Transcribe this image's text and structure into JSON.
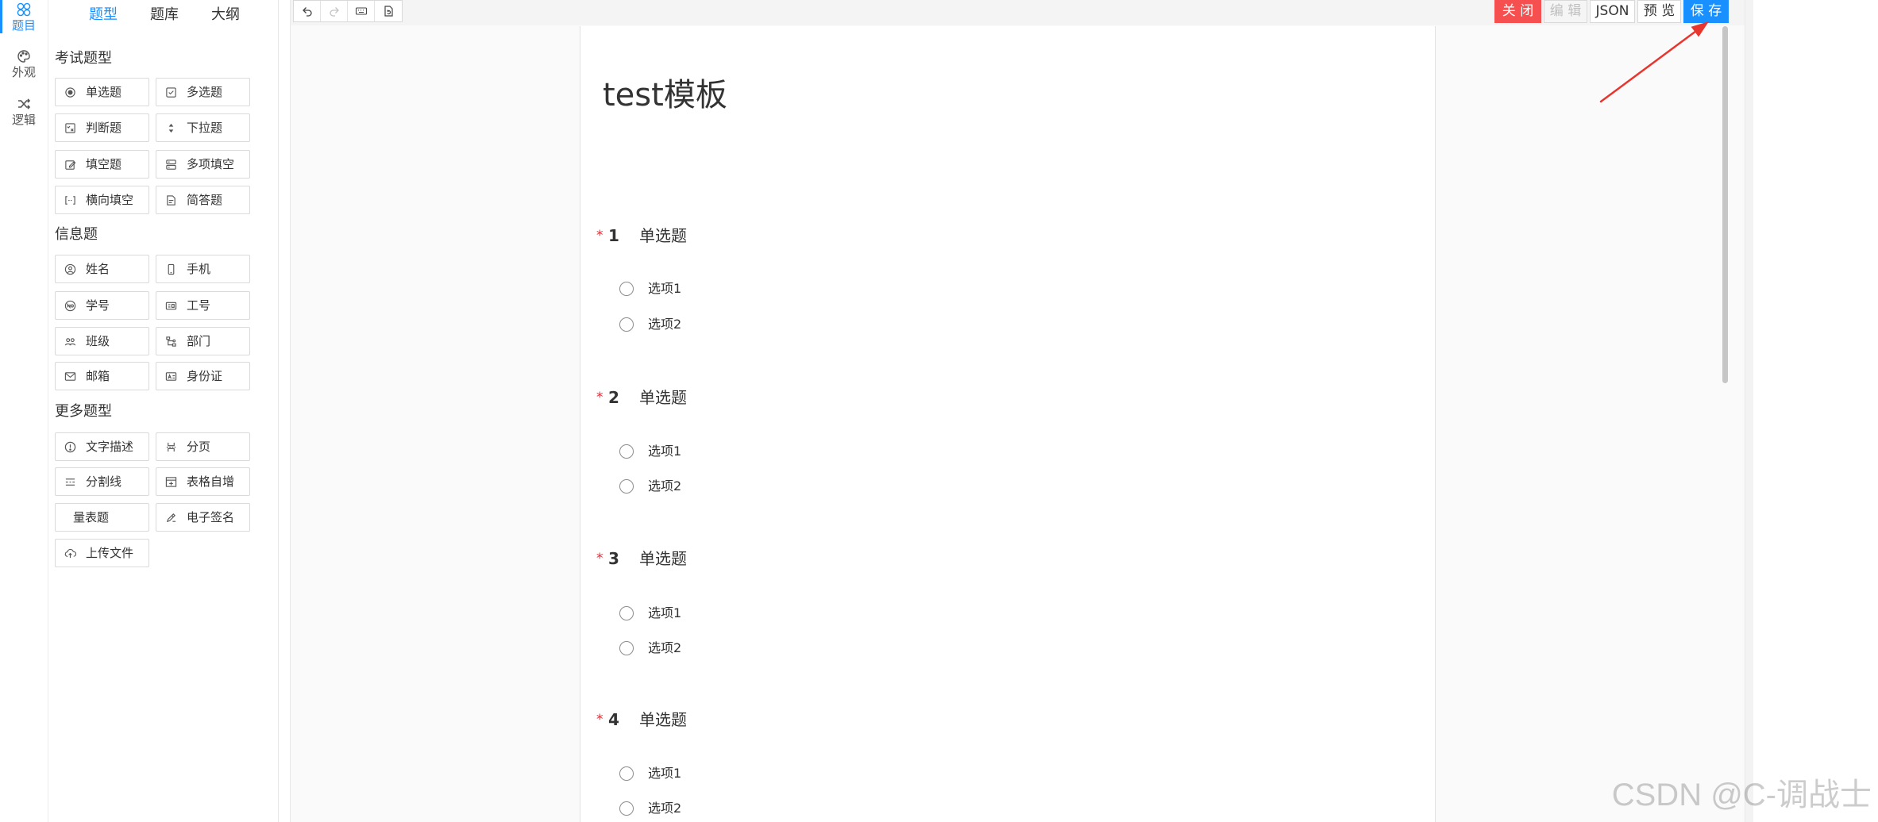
{
  "rail": {
    "items": [
      {
        "label": "题目",
        "icon": "apps-icon",
        "active": true
      },
      {
        "label": "外观",
        "icon": "palette-icon",
        "active": false
      },
      {
        "label": "逻辑",
        "icon": "shuffle-icon",
        "active": false
      }
    ]
  },
  "panel": {
    "tabs": [
      {
        "label": "题型",
        "active": true
      },
      {
        "label": "题库",
        "active": false
      },
      {
        "label": "大纲",
        "active": false
      }
    ],
    "groups": [
      {
        "title": "考试题型",
        "widgets": [
          {
            "label": "单选题",
            "icon": "radio-icon"
          },
          {
            "label": "多选题",
            "icon": "checkbox-icon"
          },
          {
            "label": "判断题",
            "icon": "true-false-icon"
          },
          {
            "label": "下拉题",
            "icon": "dropdown-icon"
          },
          {
            "label": "填空题",
            "icon": "fill-blank-icon"
          },
          {
            "label": "多项填空",
            "icon": "multi-fill-icon"
          },
          {
            "label": "横向填空",
            "icon": "inline-fill-icon"
          },
          {
            "label": "简答题",
            "icon": "short-answer-icon"
          }
        ]
      },
      {
        "title": "信息题",
        "widgets": [
          {
            "label": "姓名",
            "icon": "user-icon"
          },
          {
            "label": "手机",
            "icon": "phone-icon"
          },
          {
            "label": "学号",
            "icon": "student-no-icon"
          },
          {
            "label": "工号",
            "icon": "employee-id-icon"
          },
          {
            "label": "班级",
            "icon": "class-icon"
          },
          {
            "label": "部门",
            "icon": "department-icon"
          },
          {
            "label": "邮箱",
            "icon": "mail-icon"
          },
          {
            "label": "身份证",
            "icon": "id-card-icon"
          }
        ]
      },
      {
        "title": "更多题型",
        "widgets": [
          {
            "label": "文字描述",
            "icon": "info-icon"
          },
          {
            "label": "分页",
            "icon": "page-break-icon"
          },
          {
            "label": "分割线",
            "icon": "divider-icon"
          },
          {
            "label": "表格自增",
            "icon": "table-add-icon"
          },
          {
            "label": "量表题"
          },
          {
            "label": "电子签名",
            "icon": "signature-icon"
          },
          {
            "label": "上传文件",
            "icon": "upload-icon"
          }
        ]
      }
    ]
  },
  "toolbar": {
    "tools": [
      {
        "icon": "undo-icon",
        "enabled": true
      },
      {
        "icon": "redo-icon",
        "enabled": false
      },
      {
        "icon": "keyboard-icon",
        "enabled": true
      },
      {
        "icon": "document-reset-icon",
        "enabled": true
      }
    ]
  },
  "actions": [
    {
      "label": "关 闭",
      "bg": "#f5504f",
      "color": "#ffffff"
    },
    {
      "label": "编 辑",
      "bg": "#f5f5f5",
      "color": "#bfbfbf"
    },
    {
      "label": "JSON",
      "bg": "#ffffff",
      "color": "#333333"
    },
    {
      "label": "预 览",
      "bg": "#ffffff",
      "color": "#333333"
    },
    {
      "label": "保 存",
      "bg": "#1890ff",
      "color": "#ffffff"
    }
  ],
  "form": {
    "title": "test模板",
    "questions": [
      {
        "required": true,
        "required_mark": "*",
        "number": "1",
        "title": "单选题",
        "options": [
          "选项1",
          "选项2"
        ]
      },
      {
        "required": true,
        "required_mark": "*",
        "number": "2",
        "title": "单选题",
        "options": [
          "选项1",
          "选项2"
        ]
      },
      {
        "required": true,
        "required_mark": "*",
        "number": "3",
        "title": "单选题",
        "options": [
          "选项1",
          "选项2"
        ]
      },
      {
        "required": true,
        "required_mark": "*",
        "number": "4",
        "title": "单选题",
        "options": [
          "选项1",
          "选项2"
        ]
      }
    ]
  },
  "colors": {
    "accent": "#1890ff",
    "danger": "#f5504f",
    "required": "#f5222d",
    "annotation_arrow": "#e8352e"
  },
  "watermark": "CSDN @C-调战士"
}
